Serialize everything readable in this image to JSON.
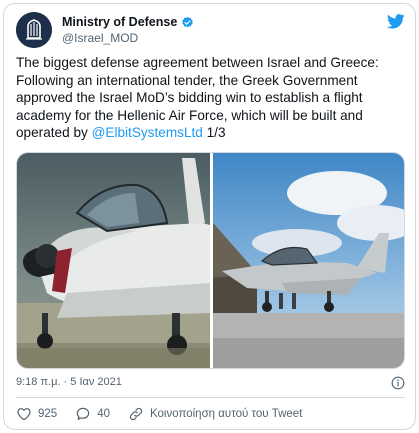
{
  "tweet": {
    "author_name": "Ministry of Defense",
    "author_handle": "@Israel_MOD",
    "text_intro": "The biggest defense agreement between Israel and Greece: Following an international tender, the Greek Government approved the Israel MoD’s bidding win to establish a flight academy for the Hellenic Air Force, which will be built and operated by ",
    "mention": "@ElbitSystemsLtd",
    "text_outro": " 1/3",
    "timestamp": "9:18 π.μ. · 5 Ιαν 2021",
    "likes": "925",
    "replies": "40",
    "share_label": "Κοινοποίηση αυτού του Tweet"
  },
  "colors": {
    "accent": "#1d9bf0",
    "like_red": "#f91880",
    "muted": "#536471",
    "border": "#cfd9de"
  },
  "icons": {
    "avatar": "mod-emblem-icon",
    "verified": "verified-badge-icon",
    "platform": "twitter-bird-icon",
    "info": "info-icon",
    "like": "heart-icon",
    "reply": "reply-bubble-icon",
    "share": "share-icon"
  },
  "media": {
    "images": [
      "plane-closeup-photo",
      "plane-on-runway-photo"
    ]
  }
}
